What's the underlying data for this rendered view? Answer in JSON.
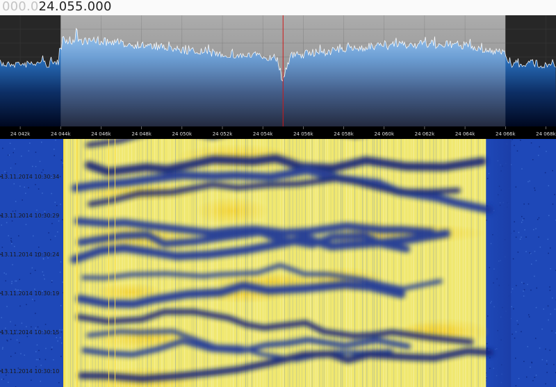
{
  "frequency_display": {
    "dim_part": "000.0",
    "main_part": "24.055.000"
  },
  "spectrum": {
    "range_khz": [
      24041,
      24068.5
    ],
    "passband_khz": [
      24044,
      24066
    ],
    "tuned_khz": 24055,
    "tick_labels": [
      "24 042k",
      "24 044k",
      "24 046k",
      "24 048k",
      "24 050k",
      "24 052k",
      "24 054k",
      "24 056k",
      "24 058k",
      "24 060k",
      "24 062k",
      "24 064k",
      "24 066k",
      "24 068k"
    ],
    "tick_values_khz": [
      24042,
      24044,
      24046,
      24048,
      24050,
      24052,
      24054,
      24056,
      24058,
      24060,
      24062,
      24064,
      24066,
      24068
    ]
  },
  "waterfall": {
    "time_labels": [
      "13.11.2014 10:30:34",
      "13.11.2014 10:30:29",
      "13.11.2014 10:30:24",
      "13.11.2014 10:30:19",
      "13.11.2014 10:30:15",
      "13.11.2014 10:30:10"
    ]
  },
  "colors": {
    "passband_gray": "#6f6f6f",
    "outside_gray": "#2a2a2a",
    "spectrum_trace": "#ffffff",
    "tuning_line": "#d01818",
    "waterfall_low": "#1030a0",
    "waterfall_high": "#f8e020"
  }
}
